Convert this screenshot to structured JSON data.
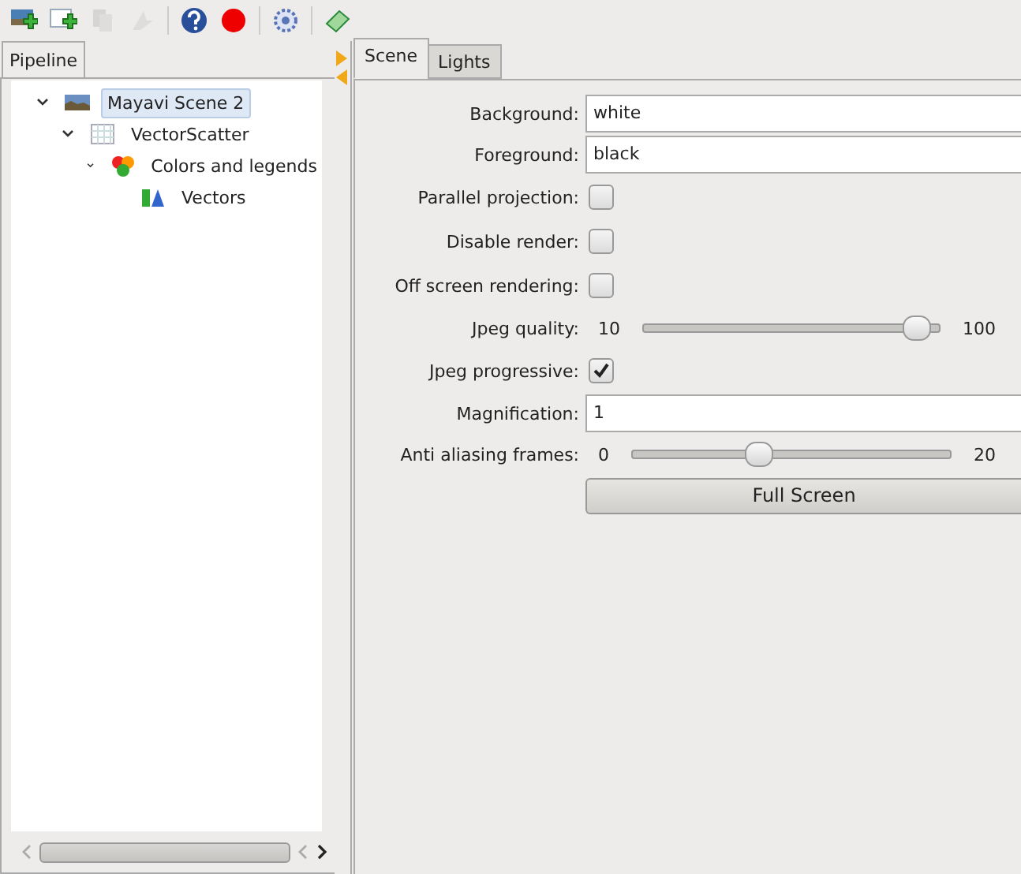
{
  "toolbar": [
    {
      "disabled": false
    },
    {
      "disabled": false
    },
    {
      "disabled": true
    },
    {
      "disabled": true
    },
    {
      "disabled": false
    },
    {
      "disabled": false
    },
    {
      "disabled": false
    },
    {
      "disabled": false
    }
  ],
  "left_tabs": [
    {
      "label": "Pipeline",
      "selected": true
    }
  ],
  "tree": [
    {
      "label": "Mayavi Scene 2",
      "selected": true,
      "expanded": true,
      "children": [
        {
          "label": "VectorScatter",
          "selected": false,
          "expanded": true,
          "children": [
            {
              "label": "Colors and legends",
              "selected": false,
              "expanded": true,
              "children": [
                {
                  "label": "Vectors",
                  "selected": false
                }
              ]
            }
          ]
        }
      ]
    }
  ],
  "tabs": [
    {
      "label": "Scene",
      "selected": true
    },
    {
      "label": "Lights",
      "selected": false
    }
  ],
  "fields": [
    {
      "kind": "text",
      "label": "Background:",
      "value": "white"
    },
    {
      "kind": "text",
      "label": "Foreground:",
      "value": "black"
    },
    {
      "kind": "checkbox",
      "label": "Parallel projection:",
      "checked": false
    },
    {
      "kind": "checkbox",
      "label": "Disable render:",
      "checked": false
    },
    {
      "kind": "checkbox",
      "label": "Off screen rendering:",
      "checked": false
    },
    {
      "kind": "slider",
      "label": "Jpeg quality:",
      "min": "10",
      "max": "100",
      "level": 0.92
    },
    {
      "kind": "checkbox",
      "label": "Jpeg progressive:",
      "checked": true
    },
    {
      "kind": "text",
      "label": "Magnification:",
      "value": "1"
    },
    {
      "kind": "slider",
      "label": "Anti aliasing frames:",
      "min": "0",
      "max": "20",
      "level": 0.4
    }
  ],
  "button": "Full Screen"
}
